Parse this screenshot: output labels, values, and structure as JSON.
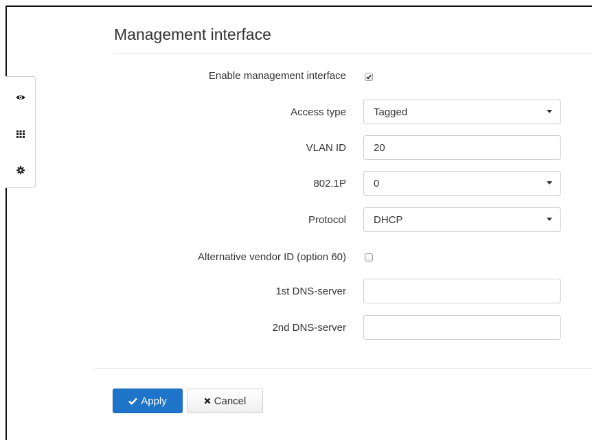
{
  "page": {
    "title": "Management interface"
  },
  "sidebar": {
    "items": [
      {
        "icon": "eye-icon"
      },
      {
        "icon": "grid-icon"
      },
      {
        "icon": "gear-icon"
      }
    ]
  },
  "form": {
    "enable_management": {
      "label": "Enable management interface",
      "checked": true
    },
    "access_type": {
      "label": "Access type",
      "value": "Tagged"
    },
    "vlan_id": {
      "label": "VLAN ID",
      "value": "20"
    },
    "priority_8021p": {
      "label": "802.1P",
      "value": "0"
    },
    "protocol": {
      "label": "Protocol",
      "value": "DHCP"
    },
    "alt_vendor_id": {
      "label": "Alternative vendor ID (option 60)",
      "checked": false
    },
    "dns1": {
      "label": "1st DNS-server",
      "value": ""
    },
    "dns2": {
      "label": "2nd DNS-server",
      "value": ""
    }
  },
  "actions": {
    "apply_label": "Apply",
    "cancel_label": "Cancel"
  },
  "colors": {
    "primary": "#1e74c8",
    "border": "#cccccc"
  }
}
